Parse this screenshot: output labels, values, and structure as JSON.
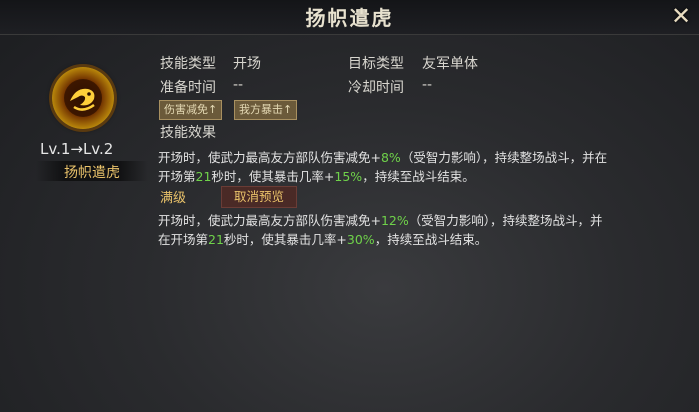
{
  "header": {
    "title": "扬帜遣虎"
  },
  "close_icon": "close-x-icon",
  "skill": {
    "level_text": "Lv.1→Lv.2",
    "name": "扬帜遣虎",
    "icon": "tiger-emblem-icon"
  },
  "info": {
    "type_label": "技能类型",
    "type_value": "开场",
    "target_label": "目标类型",
    "target_value": "友军单体",
    "prep_label": "准备时间",
    "prep_value": "--",
    "cooldown_label": "冷却时间",
    "cooldown_value": "--"
  },
  "tags": [
    "伤害减免↑",
    "我方暴击↑"
  ],
  "effect": {
    "label": "技能效果",
    "current": {
      "p1": "开场时，使武力最高友方部队伤害减免+",
      "v1": "8%",
      "p2": "（受智力影响），持续整场战斗，并在",
      "p3": "开场第",
      "v2": "21",
      "p4": "秒时，使其暴击几率+",
      "v3": "15%",
      "p5": "，持续至战斗结束。"
    }
  },
  "max_level": {
    "label": "满级",
    "preview_button": "取消预览",
    "text": {
      "p1": "开场时，使武力最高友方部队伤害减免+",
      "v1": "12%",
      "p2": "（受智力影响），持续整场战斗，并",
      "p3": "在开场第",
      "v2": "21",
      "p4": "秒时，使其暴击几率+",
      "v3": "30%",
      "p5": "，持续至战斗结束。"
    }
  },
  "colors": {
    "highlight": "#6fd24a",
    "gold": "#e9c26a"
  }
}
